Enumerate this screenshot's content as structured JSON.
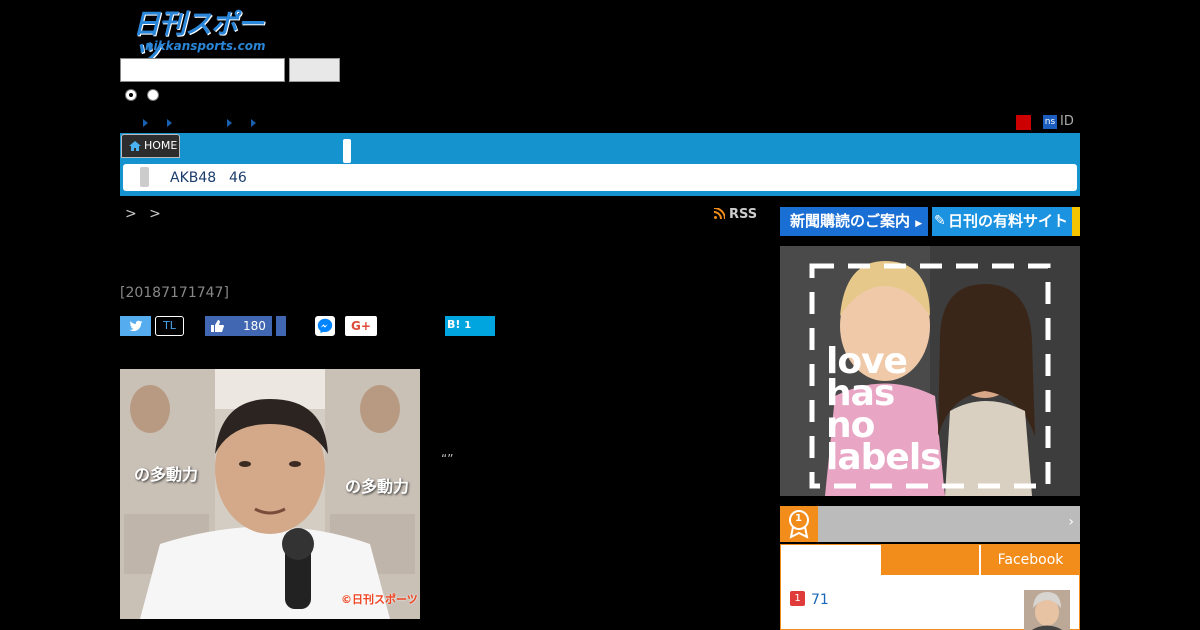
{
  "header": {
    "logo_text": "日刊スポーツ",
    "logo_domain": "nikkansports.com",
    "search_placeholder": "",
    "search_button_label": ""
  },
  "util": {
    "id_label": "ID",
    "ns_badge": "ns"
  },
  "nav": {
    "home_label": "HOME",
    "subnav": [
      "AKB48",
      "46"
    ]
  },
  "article": {
    "breadcrumb": "> >",
    "rss_label": "RSS",
    "date": "[20187171747]",
    "share": {
      "twitter_label": "",
      "tl_label": "TL",
      "facebook_count": "180",
      "googleplus_label": "G+",
      "hatena_label": "B!",
      "hatena_count": "1"
    },
    "photo_credit": "©日刊スポーツ",
    "photo_text_1": "の多動力",
    "photo_text_2": "の多動力",
    "caption_mark": "“”"
  },
  "sidebar": {
    "subscribe_label": "新聞購読のご案内",
    "paid_site_label": "日刊の有料サイト",
    "banner_lines": [
      "love",
      "has",
      "no",
      "labels"
    ],
    "ranking_medal": "1",
    "ranking_tab_facebook": "Facebook",
    "ranking_items": [
      {
        "rank": "1",
        "title": "71"
      }
    ]
  },
  "colors": {
    "nav_blue": "#1593cf",
    "ranking_orange": "#f28d1c",
    "subscribe_blue": "#1a6fd4"
  }
}
